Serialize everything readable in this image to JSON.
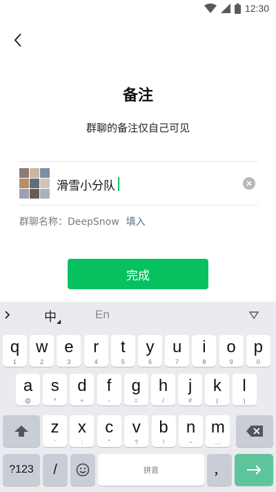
{
  "status_bar": {
    "time": "12:30"
  },
  "header": {
    "title": "备注",
    "subtitle": "群聊的备注仅自己可见"
  },
  "remark": {
    "value": "滑雪小分队"
  },
  "group_name": {
    "label": "群聊名称：DeepSnow",
    "fill_label": "填入"
  },
  "actions": {
    "done_label": "完成"
  },
  "keyboard": {
    "toolbar": {
      "chinese_label": "中",
      "english_label": "En"
    },
    "row1": [
      {
        "key": "q",
        "sub": "1"
      },
      {
        "key": "w",
        "sub": "2"
      },
      {
        "key": "e",
        "sub": "3"
      },
      {
        "key": "r",
        "sub": "4"
      },
      {
        "key": "t",
        "sub": "5"
      },
      {
        "key": "y",
        "sub": "6"
      },
      {
        "key": "u",
        "sub": "7"
      },
      {
        "key": "i",
        "sub": "8"
      },
      {
        "key": "o",
        "sub": "9"
      },
      {
        "key": "p",
        "sub": "0"
      }
    ],
    "row2": [
      {
        "key": "a",
        "sub": "@"
      },
      {
        "key": "s",
        "sub": "*"
      },
      {
        "key": "d",
        "sub": "+"
      },
      {
        "key": "f",
        "sub": "-"
      },
      {
        "key": "g",
        "sub": "="
      },
      {
        "key": "h",
        "sub": "/"
      },
      {
        "key": "j",
        "sub": "#"
      },
      {
        "key": "k",
        "sub": "("
      },
      {
        "key": "l",
        "sub": ")"
      }
    ],
    "row3": [
      {
        "key": "z",
        "sub": "'"
      },
      {
        "key": "x",
        "sub": ":"
      },
      {
        "key": "c",
        "sub": "\""
      },
      {
        "key": "v",
        "sub": "?"
      },
      {
        "key": "b",
        "sub": "!"
      },
      {
        "key": "n",
        "sub": "~"
      },
      {
        "key": "m",
        "sub": "…"
      }
    ],
    "bottom": {
      "numbers_label": "?123",
      "slash_label": "/",
      "space_label": "拼音"
    }
  },
  "colors": {
    "accent": "#07c160",
    "link": "#576b95",
    "keyboard_bg": "#e9ebee",
    "enter_key": "#5ec49b"
  }
}
